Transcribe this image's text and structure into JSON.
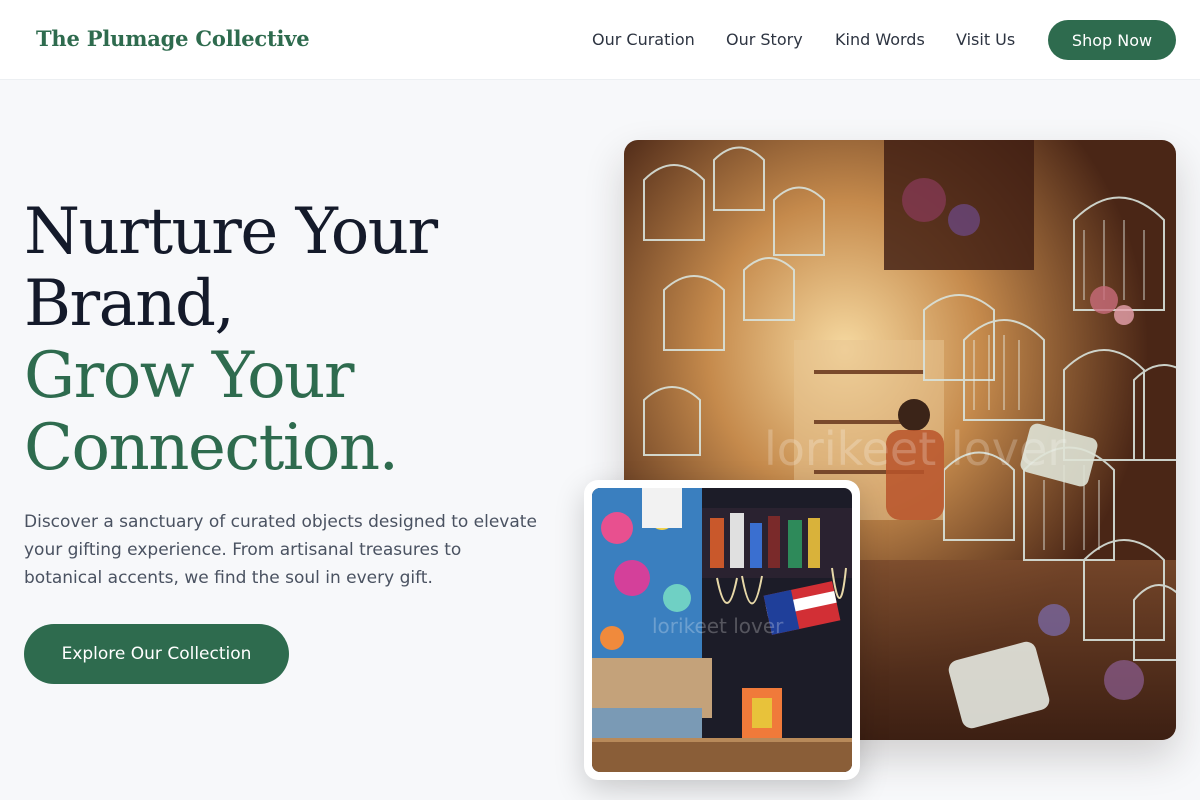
{
  "header": {
    "brand": "The Plumage Collective",
    "nav": [
      "Our Curation",
      "Our Story",
      "Kind Words",
      "Visit Us"
    ],
    "cta": "Shop Now"
  },
  "hero": {
    "line1": "Nurture Your",
    "line2": "Brand,",
    "line3": "Grow Your",
    "line4": "Connection.",
    "description": "Discover a sanctuary of curated objects designed to elevate your gifting experience. From artisanal treasures to botanical accents, we find the soul in every gift.",
    "button": "Explore Our Collection"
  },
  "images": {
    "main_watermark": "lorikeet lover",
    "inset_watermark": "lorikeet lover"
  },
  "colors": {
    "accent": "#2e6b4e",
    "headline_dark": "#141a2a",
    "background": "#f7f8fa"
  }
}
